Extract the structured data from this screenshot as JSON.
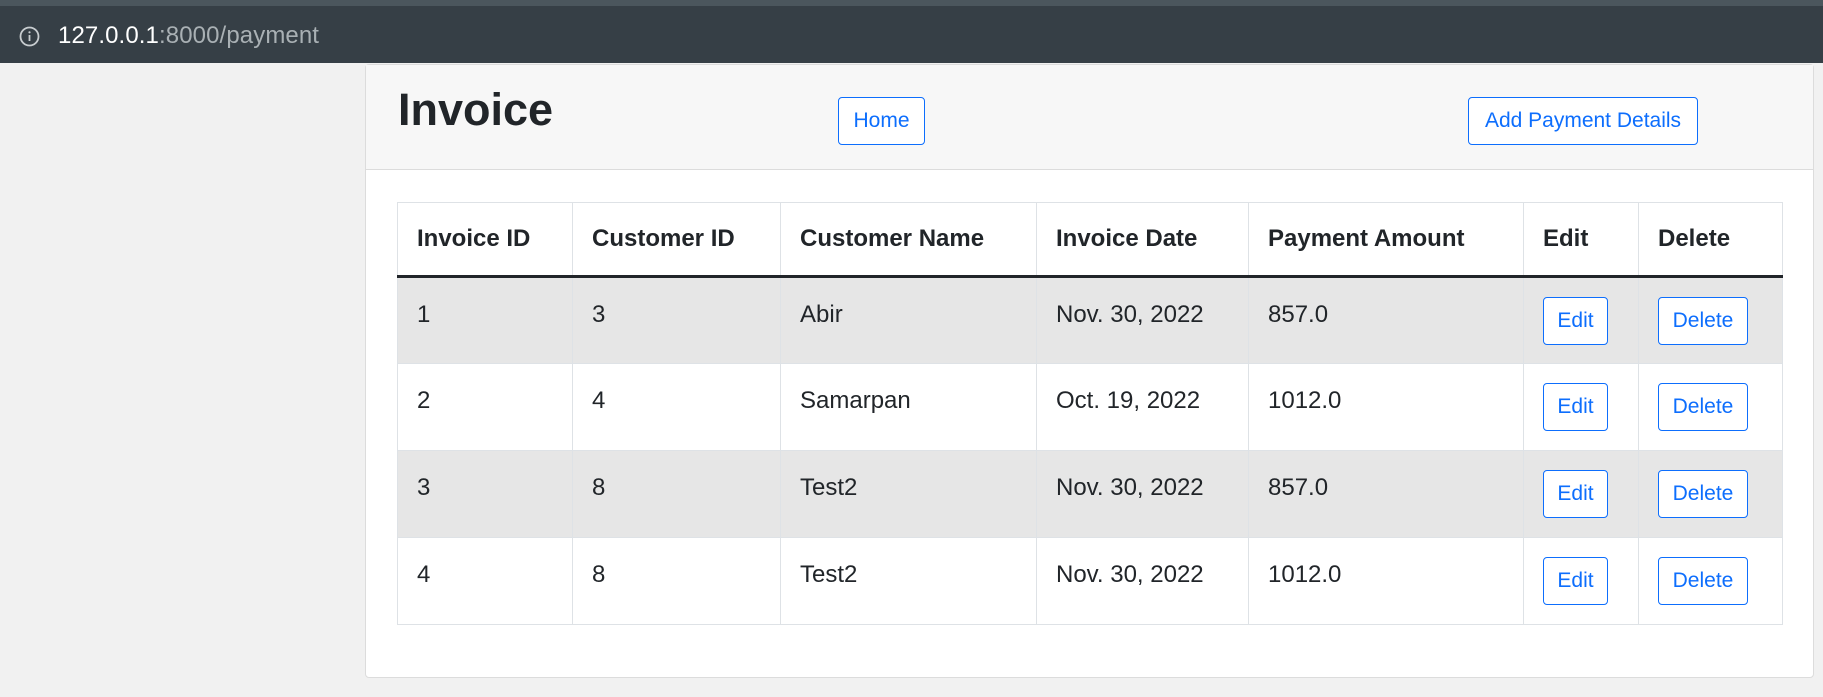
{
  "browser": {
    "url_host": "127.0.0.1",
    "url_path": ":8000/payment",
    "info_icon": "info-icon"
  },
  "header": {
    "title": "Invoice",
    "home_label": "Home",
    "add_label": "Add Payment Details"
  },
  "table": {
    "columns": [
      "Invoice ID",
      "Customer ID",
      "Customer Name",
      "Invoice Date",
      "Payment Amount",
      "Edit",
      "Delete"
    ],
    "rows": [
      {
        "invoice_id": "1",
        "customer_id": "3",
        "customer_name": "Abir",
        "invoice_date": "Nov. 30, 2022",
        "payment_amount": "857.0",
        "edit": "Edit",
        "delete": "Delete"
      },
      {
        "invoice_id": "2",
        "customer_id": "4",
        "customer_name": "Samarpan",
        "invoice_date": "Oct. 19, 2022",
        "payment_amount": "1012.0",
        "edit": "Edit",
        "delete": "Delete"
      },
      {
        "invoice_id": "3",
        "customer_id": "8",
        "customer_name": "Test2",
        "invoice_date": "Nov. 30, 2022",
        "payment_amount": "857.0",
        "edit": "Edit",
        "delete": "Delete"
      },
      {
        "invoice_id": "4",
        "customer_id": "8",
        "customer_name": "Test2",
        "invoice_date": "Nov. 30, 2022",
        "payment_amount": "1012.0",
        "edit": "Edit",
        "delete": "Delete"
      }
    ]
  },
  "colors": {
    "primary": "#0d6efd",
    "browser_bar": "#363f46",
    "striped_row": "#e6e6e6"
  }
}
